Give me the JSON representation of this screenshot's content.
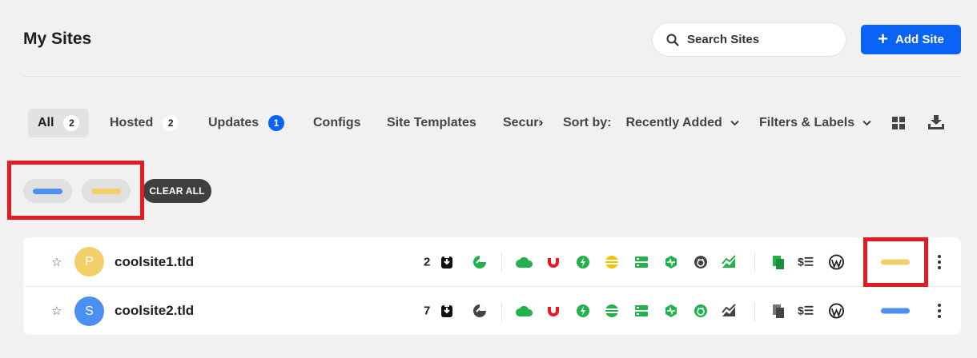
{
  "header": {
    "title": "My Sites",
    "search_placeholder": "Search Sites",
    "add_label": "Add Site"
  },
  "tabs": [
    {
      "label": "All",
      "count": "2"
    },
    {
      "label": "Hosted",
      "count": "2"
    },
    {
      "label": "Updates",
      "count": "1"
    },
    {
      "label": "Configs"
    },
    {
      "label": "Site Templates"
    },
    {
      "label": "Securi"
    }
  ],
  "sort": {
    "label": "Sort by:",
    "value": "Recently Added"
  },
  "filters_label": "Filters & Labels",
  "active_filters": {
    "clear_label": "CLEAR ALL",
    "chip_colors": [
      "#4b8ff0",
      "#f3cf6a"
    ]
  },
  "sites": [
    {
      "initial": "P",
      "avatar_color": "#f3cf6a",
      "name": "coolsite1.tld",
      "updates": "2",
      "label_color": "#f3cf6a"
    },
    {
      "initial": "S",
      "avatar_color": "#4b8ff0",
      "name": "coolsite2.tld",
      "updates": "7",
      "label_color": "#4b8ff0"
    }
  ],
  "colors": {
    "accent": "#0b63f6",
    "green": "#22b14c",
    "red": "#e51b24",
    "gray": "#555555"
  }
}
